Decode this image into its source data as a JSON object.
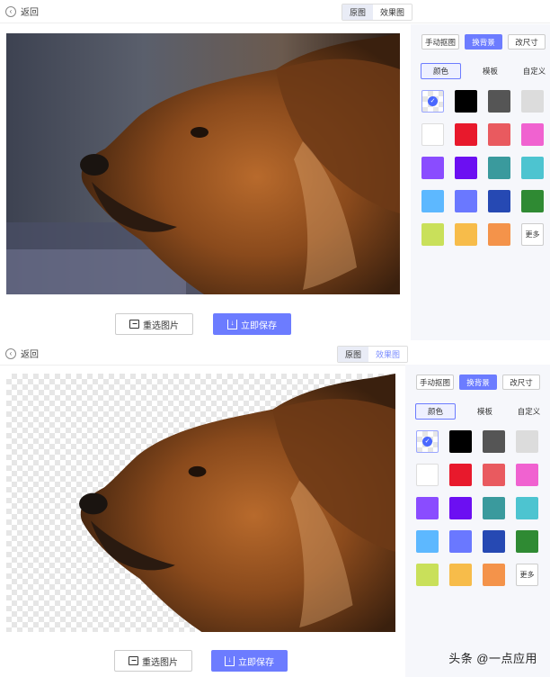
{
  "top_panel": {
    "back_label": "返回",
    "view_toggle": [
      "原图",
      "效果图"
    ],
    "sidebar": {
      "tabs": [
        "手动抠图",
        "换背景",
        "改尺寸"
      ],
      "sub_tabs": [
        "颜色",
        "模板",
        "自定义"
      ],
      "swatches": [
        "transparent",
        "#000000",
        "#555555",
        "#dcdcdc",
        "#ffffff",
        "#e8192c",
        "#e95a5f",
        "#f062d0",
        "#8a4cff",
        "#6c0ff2",
        "#3a9a9d",
        "#4dc4d0",
        "#5db8ff",
        "#6a78ff",
        "#2649b3",
        "#2f8a33",
        "#c9e05a",
        "#f7bc4a",
        "#f4934a"
      ],
      "more_label": "更多"
    },
    "buttons": {
      "reselect": "重选图片",
      "save": "立即保存"
    }
  },
  "bottom_panel": {
    "back_label": "返回",
    "view_toggle": [
      "原图",
      "效果图"
    ],
    "sidebar": {
      "tabs": [
        "手动抠图",
        "换背景",
        "改尺寸"
      ],
      "sub_tabs": [
        "颜色",
        "模板",
        "自定义"
      ],
      "swatches": [
        "transparent",
        "#000000",
        "#555555",
        "#dcdcdc",
        "#ffffff",
        "#e8192c",
        "#e95a5f",
        "#f062d0",
        "#8a4cff",
        "#6c0ff2",
        "#3a9a9d",
        "#4dc4d0",
        "#5db8ff",
        "#6a78ff",
        "#2649b3",
        "#2f8a33",
        "#c9e05a",
        "#f7bc4a",
        "#f4934a"
      ],
      "more_label": "更多"
    },
    "buttons": {
      "reselect": "重选图片",
      "save": "立即保存"
    }
  },
  "watermark": "头条 @一点应用",
  "colors": {
    "accent": "#6c7cff",
    "sidebar_bg": "#f6f7fb"
  }
}
